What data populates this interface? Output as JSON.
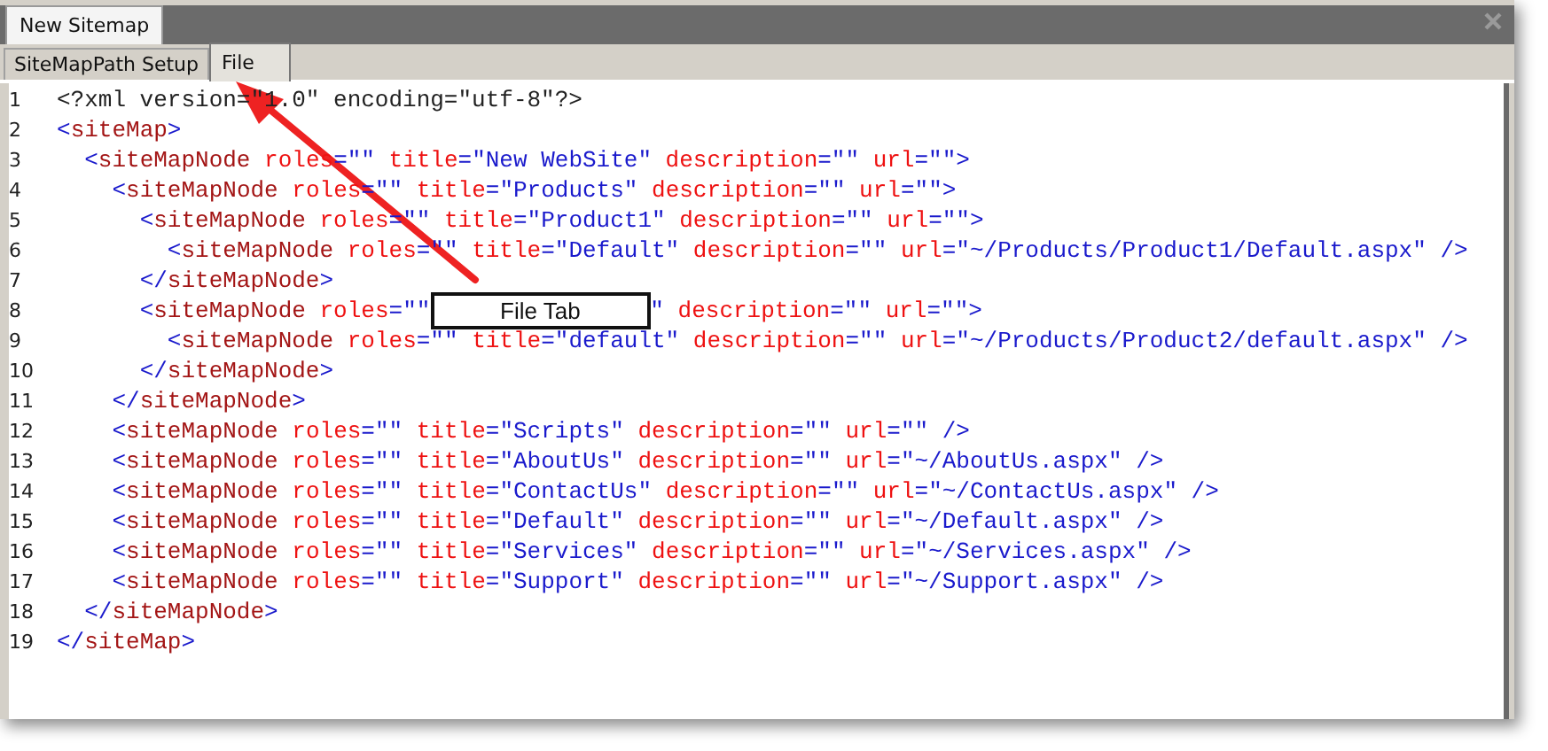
{
  "window": {
    "title": "New Sitemap"
  },
  "tabs": [
    {
      "label": "SiteMapPath Setup",
      "selected": false
    },
    {
      "label": "File",
      "selected": true
    }
  ],
  "editor": {
    "lines": [
      {
        "number": "1",
        "tokens": [
          {
            "kind": "text",
            "text": "<?xml version=\"1.0\" encoding=\"utf-8\"?>"
          }
        ]
      },
      {
        "number": "2",
        "tokens": [
          {
            "kind": "punct",
            "text": "<"
          },
          {
            "kind": "tag",
            "text": "siteMap"
          },
          {
            "kind": "punct",
            "text": ">"
          }
        ]
      },
      {
        "number": "3",
        "tokens": [
          {
            "kind": "punct",
            "text": "  <"
          },
          {
            "kind": "tag",
            "text": "siteMapNode"
          },
          {
            "kind": "attr",
            "text": " roles"
          },
          {
            "kind": "value",
            "text": "=\"\""
          },
          {
            "kind": "attr",
            "text": " title"
          },
          {
            "kind": "value",
            "text": "=\"New WebSite\""
          },
          {
            "kind": "attr",
            "text": " description"
          },
          {
            "kind": "value",
            "text": "=\"\""
          },
          {
            "kind": "attr",
            "text": " url"
          },
          {
            "kind": "value",
            "text": "=\"\""
          },
          {
            "kind": "punct",
            "text": ">"
          }
        ]
      },
      {
        "number": "4",
        "tokens": [
          {
            "kind": "punct",
            "text": "    <"
          },
          {
            "kind": "tag",
            "text": "siteMapNode"
          },
          {
            "kind": "attr",
            "text": " roles"
          },
          {
            "kind": "value",
            "text": "=\"\""
          },
          {
            "kind": "attr",
            "text": " title"
          },
          {
            "kind": "value",
            "text": "=\"Products\""
          },
          {
            "kind": "attr",
            "text": " description"
          },
          {
            "kind": "value",
            "text": "=\"\""
          },
          {
            "kind": "attr",
            "text": " url"
          },
          {
            "kind": "value",
            "text": "=\"\""
          },
          {
            "kind": "punct",
            "text": ">"
          }
        ]
      },
      {
        "number": "5",
        "tokens": [
          {
            "kind": "punct",
            "text": "      <"
          },
          {
            "kind": "tag",
            "text": "siteMapNode"
          },
          {
            "kind": "attr",
            "text": " roles"
          },
          {
            "kind": "value",
            "text": "=\"\""
          },
          {
            "kind": "attr",
            "text": " title"
          },
          {
            "kind": "value",
            "text": "=\"Product1\""
          },
          {
            "kind": "attr",
            "text": " description"
          },
          {
            "kind": "value",
            "text": "=\"\""
          },
          {
            "kind": "attr",
            "text": " url"
          },
          {
            "kind": "value",
            "text": "=\"\""
          },
          {
            "kind": "punct",
            "text": ">"
          }
        ]
      },
      {
        "number": "6",
        "tokens": [
          {
            "kind": "punct",
            "text": "        <"
          },
          {
            "kind": "tag",
            "text": "siteMapNode"
          },
          {
            "kind": "attr",
            "text": " roles"
          },
          {
            "kind": "value",
            "text": "=\"\""
          },
          {
            "kind": "attr",
            "text": " title"
          },
          {
            "kind": "value",
            "text": "=\"Default\""
          },
          {
            "kind": "attr",
            "text": " description"
          },
          {
            "kind": "value",
            "text": "=\"\""
          },
          {
            "kind": "attr",
            "text": " url"
          },
          {
            "kind": "value",
            "text": "=\"~/Products/Product1/Default.aspx\""
          },
          {
            "kind": "punct",
            "text": " />"
          }
        ]
      },
      {
        "number": "7",
        "tokens": [
          {
            "kind": "punct",
            "text": "      </"
          },
          {
            "kind": "tag",
            "text": "siteMapNode"
          },
          {
            "kind": "punct",
            "text": ">"
          }
        ]
      },
      {
        "number": "8",
        "tokens": [
          {
            "kind": "punct",
            "text": "      <"
          },
          {
            "kind": "tag",
            "text": "siteMapNode"
          },
          {
            "kind": "attr",
            "text": " roles"
          },
          {
            "kind": "value",
            "text": "=\"\""
          },
          {
            "kind": "callout",
            "text": "File Tab"
          },
          {
            "kind": "value",
            "text": "\""
          },
          {
            "kind": "attr",
            "text": " description"
          },
          {
            "kind": "value",
            "text": "=\"\""
          },
          {
            "kind": "attr",
            "text": " url"
          },
          {
            "kind": "value",
            "text": "=\"\""
          },
          {
            "kind": "punct",
            "text": ">"
          }
        ]
      },
      {
        "number": "9",
        "tokens": [
          {
            "kind": "punct",
            "text": "        <"
          },
          {
            "kind": "tag",
            "text": "siteMapNode"
          },
          {
            "kind": "attr",
            "text": " roles"
          },
          {
            "kind": "value",
            "text": "=\"\""
          },
          {
            "kind": "attr",
            "text": " title"
          },
          {
            "kind": "value",
            "text": "=\"default\""
          },
          {
            "kind": "attr",
            "text": " description"
          },
          {
            "kind": "value",
            "text": "=\"\""
          },
          {
            "kind": "attr",
            "text": " url"
          },
          {
            "kind": "value",
            "text": "=\"~/Products/Product2/default.aspx\""
          },
          {
            "kind": "punct",
            "text": " />"
          }
        ]
      },
      {
        "number": "10",
        "tokens": [
          {
            "kind": "punct",
            "text": "      </"
          },
          {
            "kind": "tag",
            "text": "siteMapNode"
          },
          {
            "kind": "punct",
            "text": ">"
          }
        ]
      },
      {
        "number": "11",
        "tokens": [
          {
            "kind": "punct",
            "text": "    </"
          },
          {
            "kind": "tag",
            "text": "siteMapNode"
          },
          {
            "kind": "punct",
            "text": ">"
          }
        ]
      },
      {
        "number": "12",
        "tokens": [
          {
            "kind": "punct",
            "text": "    <"
          },
          {
            "kind": "tag",
            "text": "siteMapNode"
          },
          {
            "kind": "attr",
            "text": " roles"
          },
          {
            "kind": "value",
            "text": "=\"\""
          },
          {
            "kind": "attr",
            "text": " title"
          },
          {
            "kind": "value",
            "text": "=\"Scripts\""
          },
          {
            "kind": "attr",
            "text": " description"
          },
          {
            "kind": "value",
            "text": "=\"\""
          },
          {
            "kind": "attr",
            "text": " url"
          },
          {
            "kind": "value",
            "text": "=\"\""
          },
          {
            "kind": "punct",
            "text": " />"
          }
        ]
      },
      {
        "number": "13",
        "tokens": [
          {
            "kind": "punct",
            "text": "    <"
          },
          {
            "kind": "tag",
            "text": "siteMapNode"
          },
          {
            "kind": "attr",
            "text": " roles"
          },
          {
            "kind": "value",
            "text": "=\"\""
          },
          {
            "kind": "attr",
            "text": " title"
          },
          {
            "kind": "value",
            "text": "=\"AboutUs\""
          },
          {
            "kind": "attr",
            "text": " description"
          },
          {
            "kind": "value",
            "text": "=\"\""
          },
          {
            "kind": "attr",
            "text": " url"
          },
          {
            "kind": "value",
            "text": "=\"~/AboutUs.aspx\""
          },
          {
            "kind": "punct",
            "text": " />"
          }
        ]
      },
      {
        "number": "14",
        "tokens": [
          {
            "kind": "punct",
            "text": "    <"
          },
          {
            "kind": "tag",
            "text": "siteMapNode"
          },
          {
            "kind": "attr",
            "text": " roles"
          },
          {
            "kind": "value",
            "text": "=\"\""
          },
          {
            "kind": "attr",
            "text": " title"
          },
          {
            "kind": "value",
            "text": "=\"ContactUs\""
          },
          {
            "kind": "attr",
            "text": " description"
          },
          {
            "kind": "value",
            "text": "=\"\""
          },
          {
            "kind": "attr",
            "text": " url"
          },
          {
            "kind": "value",
            "text": "=\"~/ContactUs.aspx\""
          },
          {
            "kind": "punct",
            "text": " />"
          }
        ]
      },
      {
        "number": "15",
        "tokens": [
          {
            "kind": "punct",
            "text": "    <"
          },
          {
            "kind": "tag",
            "text": "siteMapNode"
          },
          {
            "kind": "attr",
            "text": " roles"
          },
          {
            "kind": "value",
            "text": "=\"\""
          },
          {
            "kind": "attr",
            "text": " title"
          },
          {
            "kind": "value",
            "text": "=\"Default\""
          },
          {
            "kind": "attr",
            "text": " description"
          },
          {
            "kind": "value",
            "text": "=\"\""
          },
          {
            "kind": "attr",
            "text": " url"
          },
          {
            "kind": "value",
            "text": "=\"~/Default.aspx\""
          },
          {
            "kind": "punct",
            "text": " />"
          }
        ]
      },
      {
        "number": "16",
        "tokens": [
          {
            "kind": "punct",
            "text": "    <"
          },
          {
            "kind": "tag",
            "text": "siteMapNode"
          },
          {
            "kind": "attr",
            "text": " roles"
          },
          {
            "kind": "value",
            "text": "=\"\""
          },
          {
            "kind": "attr",
            "text": " title"
          },
          {
            "kind": "value",
            "text": "=\"Services\""
          },
          {
            "kind": "attr",
            "text": " description"
          },
          {
            "kind": "value",
            "text": "=\"\""
          },
          {
            "kind": "attr",
            "text": " url"
          },
          {
            "kind": "value",
            "text": "=\"~/Services.aspx\""
          },
          {
            "kind": "punct",
            "text": " />"
          }
        ]
      },
      {
        "number": "17",
        "tokens": [
          {
            "kind": "punct",
            "text": "    <"
          },
          {
            "kind": "tag",
            "text": "siteMapNode"
          },
          {
            "kind": "attr",
            "text": " roles"
          },
          {
            "kind": "value",
            "text": "=\"\""
          },
          {
            "kind": "attr",
            "text": " title"
          },
          {
            "kind": "value",
            "text": "=\"Support\""
          },
          {
            "kind": "attr",
            "text": " description"
          },
          {
            "kind": "value",
            "text": "=\"\""
          },
          {
            "kind": "attr",
            "text": " url"
          },
          {
            "kind": "value",
            "text": "=\"~/Support.aspx\""
          },
          {
            "kind": "punct",
            "text": " />"
          }
        ]
      },
      {
        "number": "18",
        "tokens": [
          {
            "kind": "punct",
            "text": "  </"
          },
          {
            "kind": "tag",
            "text": "siteMapNode"
          },
          {
            "kind": "punct",
            "text": ">"
          }
        ]
      },
      {
        "number": "19",
        "tokens": [
          {
            "kind": "punct",
            "text": "</"
          },
          {
            "kind": "tag",
            "text": "siteMap"
          },
          {
            "kind": "punct",
            "text": ">"
          }
        ]
      }
    ]
  }
}
